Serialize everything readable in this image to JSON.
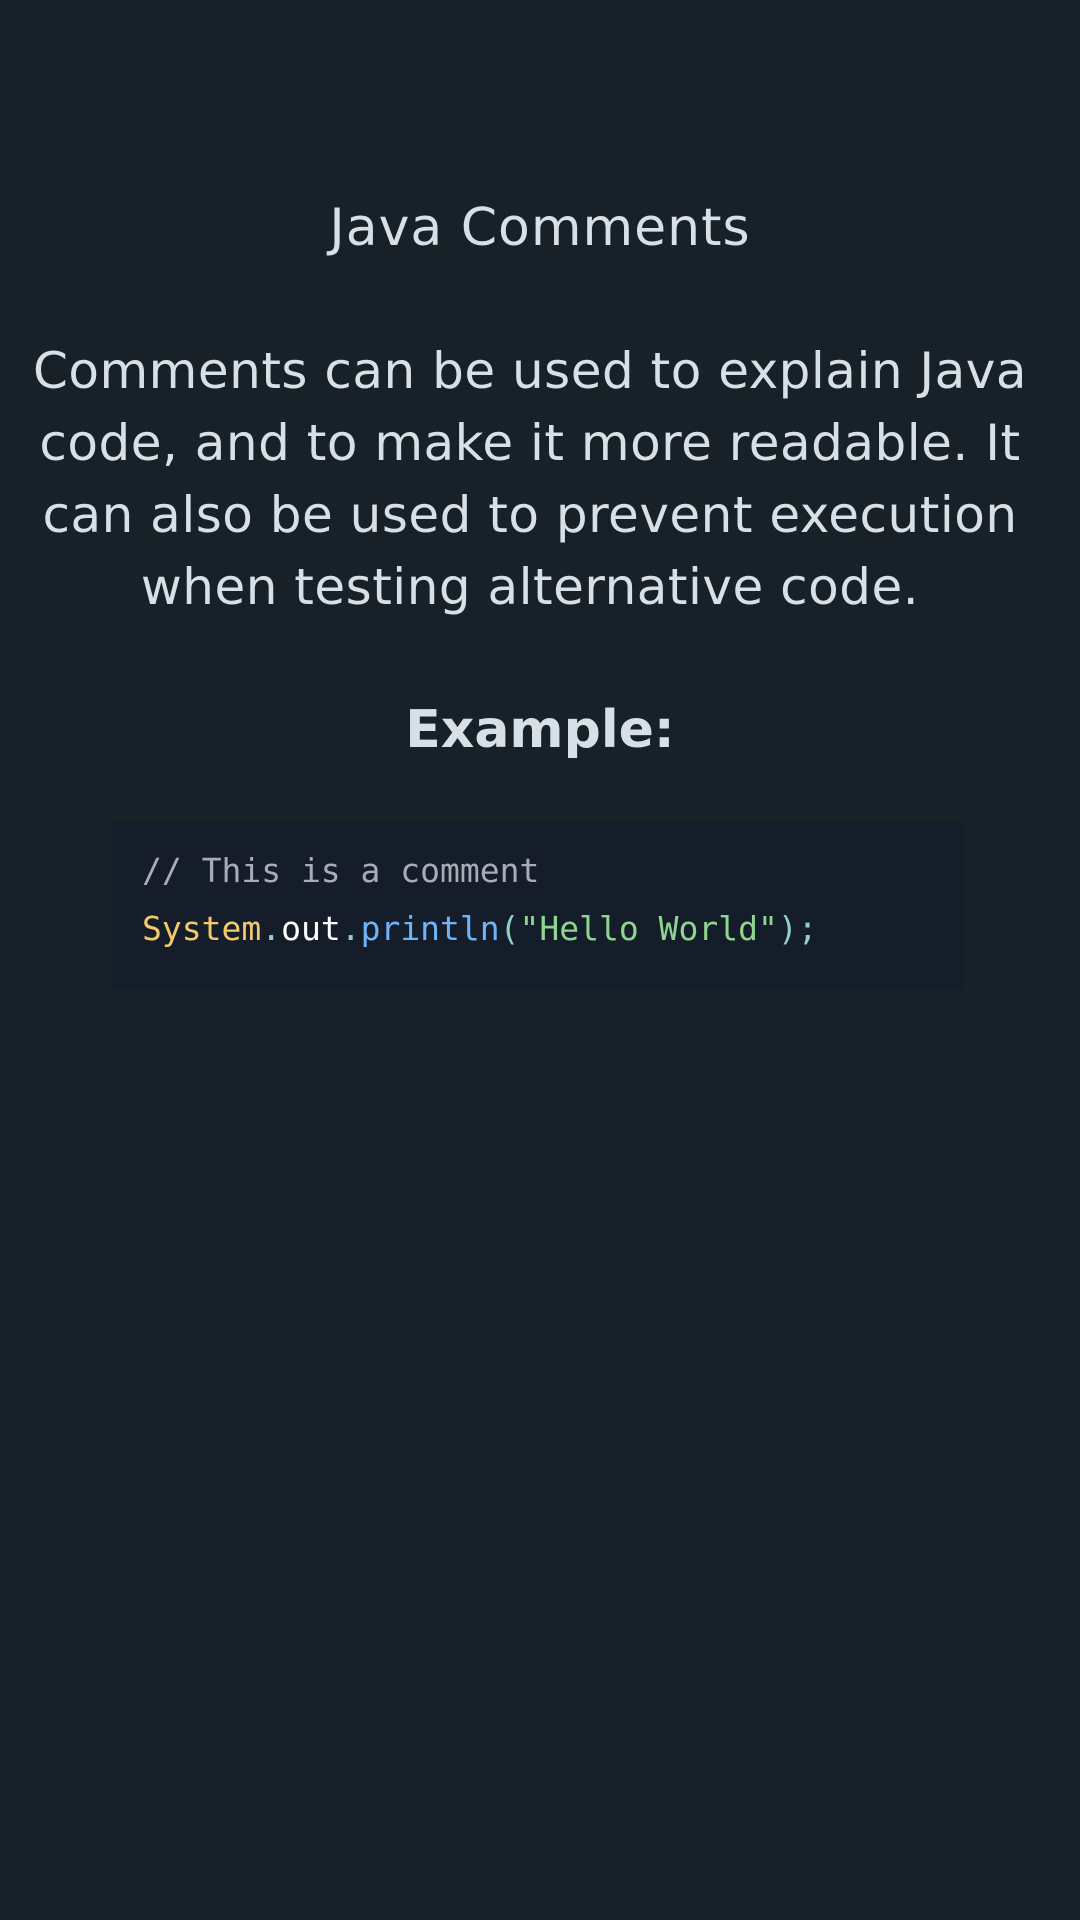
{
  "title": "Java Comments",
  "description": "Comments can be used to explain Java code, and to make it more readable. It can also be used to prevent execution when testing alternative code.",
  "example_label": "Example:",
  "code": {
    "comment_line": "// This is a comment",
    "tokens": {
      "class_name": "System",
      "dot1": ".",
      "field": "out",
      "dot2": ".",
      "method": "println",
      "open_paren": "(",
      "string": "\"Hello World\"",
      "close": ");"
    }
  },
  "colors": {
    "background": "#182028",
    "code_background": "#151d2a",
    "text": "#d7e0e6",
    "comment": "#a6adb6",
    "class_name": "#f2c96c",
    "field": "#ffffff",
    "method": "#6fb4f7",
    "string": "#8fd58f",
    "punctuation": "#8fd0c8"
  }
}
